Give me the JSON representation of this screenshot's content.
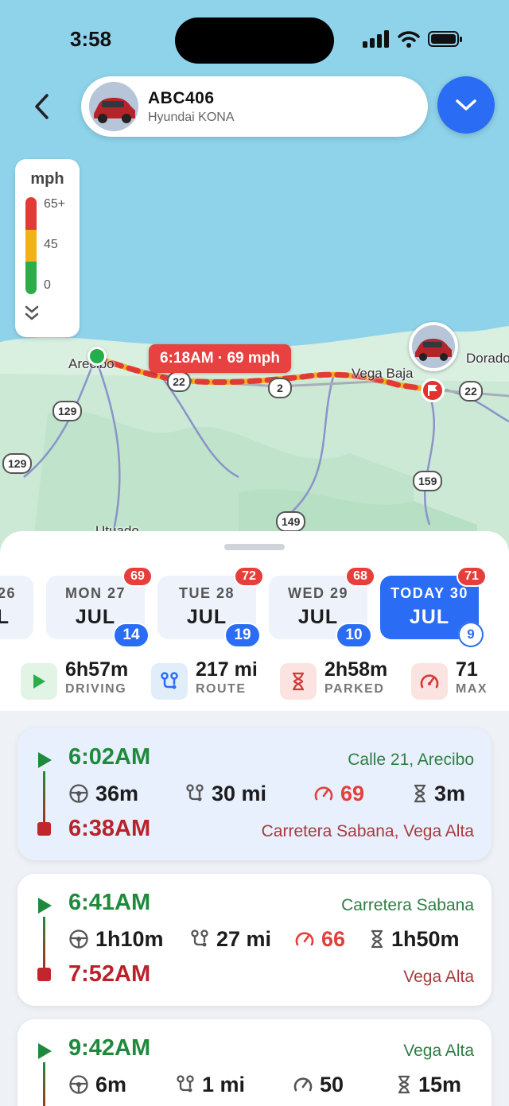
{
  "status_bar": {
    "time": "3:58"
  },
  "header": {
    "plate": "ABC406",
    "model": "Hyundai KONA"
  },
  "legend": {
    "unit": "mph",
    "levels": [
      "65+",
      "45",
      "0"
    ],
    "colors": {
      "high": "#e23b36",
      "mid": "#f0b214",
      "low": "#2dad4a"
    }
  },
  "map": {
    "places": {
      "arecibo": "Arecibo",
      "vega_baja": "Vega Baja",
      "dorado": "Dorado",
      "utuado": "Utuado"
    },
    "shields": [
      "22",
      "2",
      "22",
      "129",
      "129",
      "159",
      "149"
    ],
    "speed_tooltip": "6:18AM · 69 mph"
  },
  "days": [
    {
      "dow": "26",
      "month": "JUL"
    },
    {
      "dow": "MON 27",
      "month": "JUL",
      "max": "69",
      "trips": "14"
    },
    {
      "dow": "TUE 28",
      "month": "JUL",
      "max": "72",
      "trips": "19"
    },
    {
      "dow": "WED 29",
      "month": "JUL",
      "max": "68",
      "trips": "10"
    },
    {
      "dow": "TODAY 30",
      "month": "JUL",
      "max": "71",
      "trips": "9"
    }
  ],
  "stats": {
    "driving": {
      "value": "6h57m",
      "label": "DRIVING"
    },
    "route": {
      "value": "217 mi",
      "label": "ROUTE"
    },
    "parked": {
      "value": "2h58m",
      "label": "PARKED"
    },
    "max": {
      "value": "71",
      "label": "MAX"
    }
  },
  "trips": [
    {
      "start_time": "6:02AM",
      "end_time": "6:38AM",
      "start_addr": "Calle 21, Arecibo",
      "end_addr": "Carretera Sabana, Vega Alta",
      "duration": "36m",
      "distance": "30 mi",
      "max_speed": "69",
      "parked": "3m"
    },
    {
      "start_time": "6:41AM",
      "end_time": "7:52AM",
      "start_addr": "Carretera Sabana",
      "end_addr": "Vega Alta",
      "duration": "1h10m",
      "distance": "27 mi",
      "max_speed": "66",
      "parked": "1h50m"
    },
    {
      "start_time": "9:42AM",
      "start_addr": "Vega Alta",
      "duration": "6m",
      "distance": "1 mi",
      "max_speed": "50",
      "parked": "15m"
    }
  ],
  "colors": {
    "accent": "#2a6df4",
    "start": "#1f8a3c",
    "end": "#b8222a",
    "alert": "#e63e3a"
  }
}
